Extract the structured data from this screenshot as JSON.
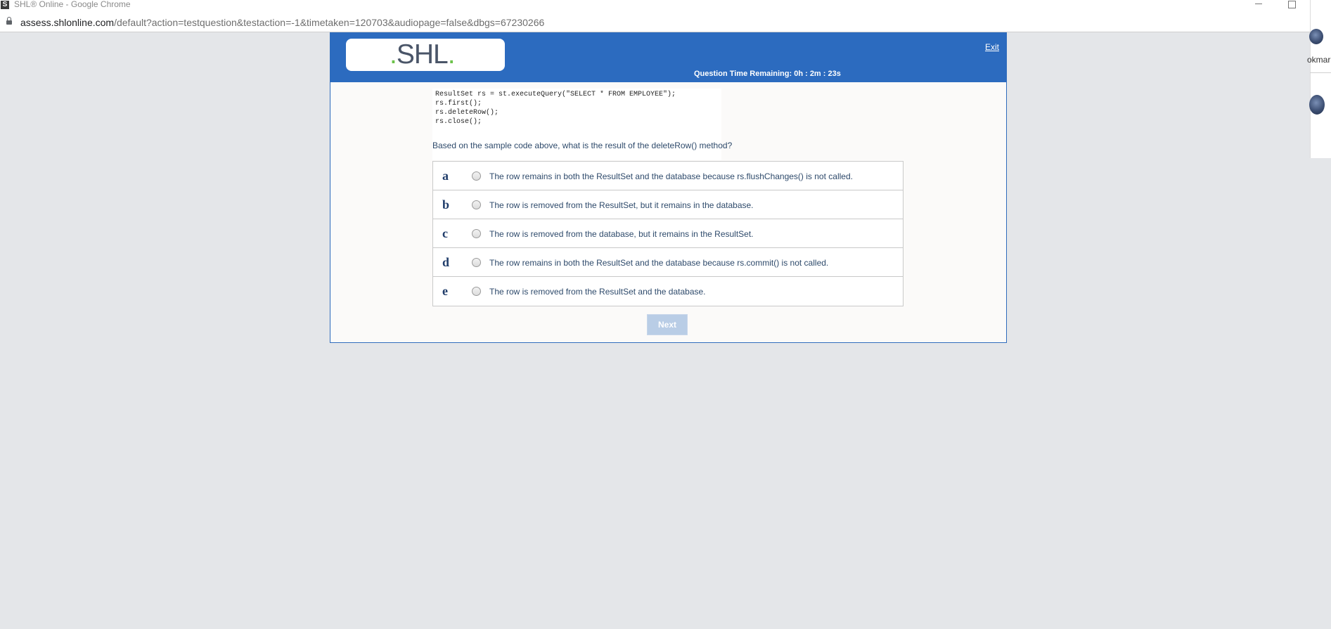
{
  "window": {
    "title": "SHL® Online - Google Chrome",
    "app_icon_glyph": "S"
  },
  "address_bar": {
    "host": "assess.shlonline.com",
    "path": "/default?action=testquestion&testaction=-1&timetaken=120703&audiopage=false&dbgs=67230266"
  },
  "side_panel": {
    "label": "okmar"
  },
  "header": {
    "logo_text": "SHL",
    "exit_label": "Exit",
    "timer_text": "Question Time Remaining: 0h : 2m : 23s"
  },
  "question": {
    "code_lines": [
      "ResultSet rs = st.executeQuery(\"SELECT * FROM EMPLOYEE\");",
      "rs.first();",
      "rs.deleteRow();",
      "rs.close();"
    ],
    "prompt": "Based on the sample code above, what is the result of the deleteRow() method?",
    "options": [
      {
        "letter": "a",
        "text": "The row remains in both the ResultSet and the database because rs.flushChanges() is not called."
      },
      {
        "letter": "b",
        "text": "The row is removed from the ResultSet, but it remains in the database."
      },
      {
        "letter": "c",
        "text": "The row is removed from the database, but it remains in the ResultSet."
      },
      {
        "letter": "d",
        "text": "The row remains in both the ResultSet and the database because rs.commit() is not called."
      },
      {
        "letter": "e",
        "text": "The row is removed from the ResultSet and the database."
      }
    ]
  },
  "footer": {
    "next_label": "Next"
  },
  "colors": {
    "header_blue": "#2c6bbf",
    "logo_accent": "#6cc24a",
    "next_disabled": "#b9cde6"
  }
}
